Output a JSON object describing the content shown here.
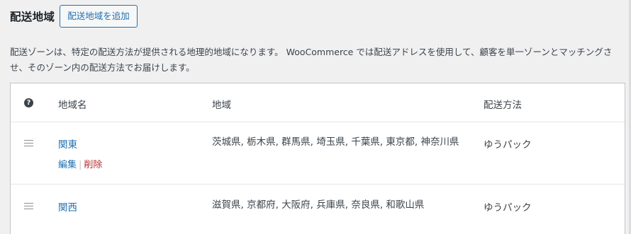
{
  "header": {
    "title": "配送地域",
    "add_button_label": "配送地域を追加"
  },
  "description": "配送ゾーンは、特定の配送方法が提供される地理的地域になります。 WooCommerce では配送アドレスを使用して、顧客を単一ゾーンとマッチングさせ、そのゾーン内の配送方法でお届けします。",
  "table": {
    "help_icon": "?",
    "columns": {
      "name": "地域名",
      "regions": "地域",
      "methods": "配送方法"
    },
    "rows": [
      {
        "name": "関東",
        "regions": "茨城県, 栃木県, 群馬県, 埼玉県, 千葉県, 東京都, 神奈川県",
        "methods": "ゆうパック",
        "actions": {
          "edit": "編集",
          "separator": "|",
          "delete": "削除"
        }
      },
      {
        "name": "関西",
        "regions": "滋賀県, 京都府, 大阪府, 兵庫県, 奈良県, 和歌山県",
        "methods": "ゆうパック"
      }
    ]
  }
}
